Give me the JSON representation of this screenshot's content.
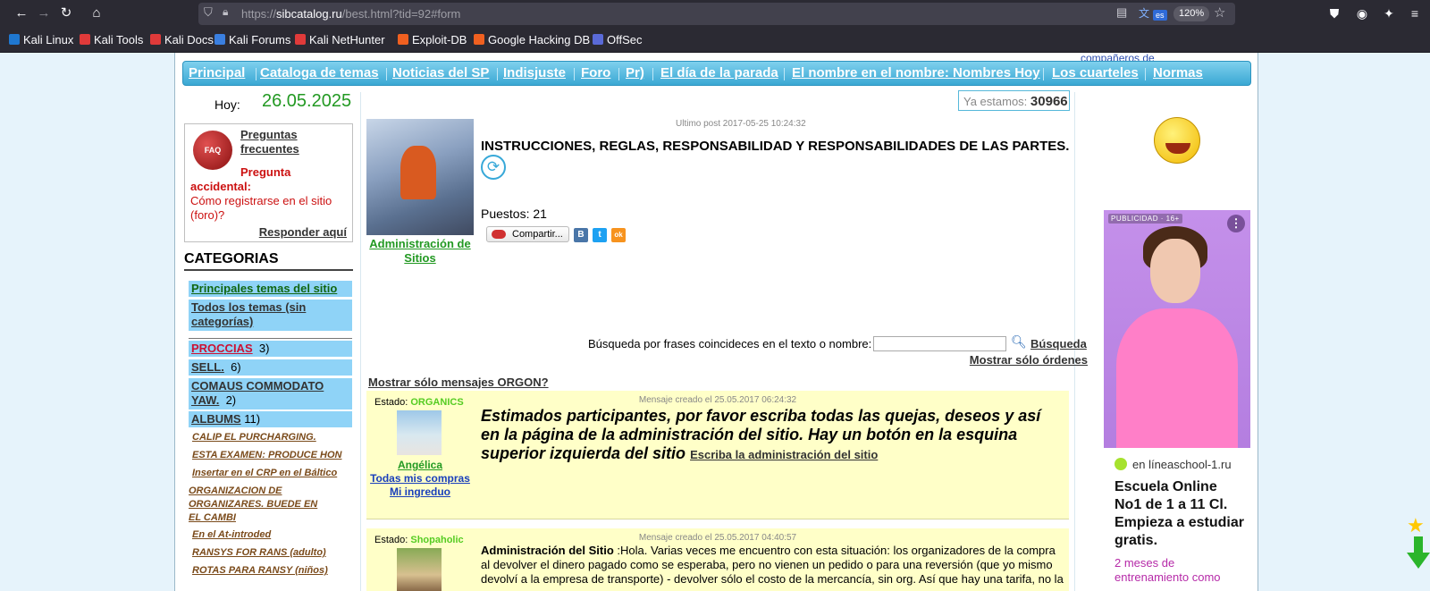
{
  "browser": {
    "url_prefix": "https://",
    "url_host": "sibcatalog.ru",
    "url_path": "/best.html?tid=92#form",
    "translate_lang": "es",
    "zoom": "120%",
    "bookmarks": [
      "Kali Linux",
      "Kali Tools",
      "Kali Docs",
      "Kali Forums",
      "Kali NetHunter",
      "Exploit-DB",
      "Google Hacking DB",
      "OffSec"
    ]
  },
  "page": {
    "top_cut_text": "compañeros de",
    "nav": [
      "Principal",
      "Cataloga de temas",
      "Noticias del SP",
      "Indisjuste",
      "Foro",
      "Pr)",
      "El día de la parada",
      "El nombre en el nombre: Nombres Hoy",
      "Los cuarteles",
      "Normas"
    ],
    "today_label": "Hoy:",
    "today_date": "26.05.2025",
    "counter_label": "Ya estamos:",
    "counter_value": "30966",
    "faq": {
      "dice_text": "FAQ",
      "title": "Preguntas frecuentes",
      "question_label_1": "Pregunta",
      "question_label_2": "accidental:",
      "question": "Cómo registrarse en el sitio (foro)?",
      "reply": "Responder aquí"
    },
    "categories_title": "CATEGORIAS",
    "categories": [
      {
        "label": "Principales temas del sitio",
        "count": ""
      },
      {
        "label": "Todos los temas (sin categorías)",
        "count": ""
      },
      {
        "label": "PROCCIAS",
        "count": "3)"
      },
      {
        "label": "SELL.",
        "count": "6)"
      },
      {
        "label": "COMAUS COMMODATO YAW.",
        "count": "2)"
      },
      {
        "label": "ALBUMS",
        "count": "11)"
      }
    ],
    "subcategories": [
      "CALIP EL PURCHARGING.",
      "ESTA EXAMEN: PRODUCE HON",
      "Insertar en el CRP en el Báltico",
      "ORGANIZACION DE ORGANIZARES. BUEDE EN EL CAMBI",
      "En el At-introded",
      "RANSYS FOR RANS (adulto)",
      "ROTAS PARA RANSY (niños)"
    ],
    "topic": {
      "author": "Administración de Sitios",
      "last_post": "Ultimo post 2017-05-25 10:24:32",
      "title": "INSTRUCCIONES, REGLAS, RESPONSABILIDAD Y RESPONSABILIDADES DE LAS PARTES.",
      "posts": "Puestos: 21",
      "share": "Compartir..."
    },
    "social": [
      {
        "icon": "vk-icon",
        "glyph": "B",
        "color": "#4a76a8"
      },
      {
        "icon": "twitter-icon",
        "glyph": "t",
        "color": "#1da1f2"
      },
      {
        "icon": "odnoklassniki-icon",
        "glyph": "ok",
        "color": "#f7931e"
      }
    ],
    "search": {
      "label": "Búsqueda por frases coincideces en el texto o nombre:",
      "button": "Búsqueda",
      "orders_link": "Mostrar sólo órdenes"
    },
    "orgon_link": "Mostrar sólo mensajes ORGON?",
    "posts": [
      {
        "date": "Mensaje creado el 25.05.2017 06:24:32",
        "status_label": "Estado:",
        "status": "ORGANICS",
        "user": "Angélica",
        "link1": "Todas mis compras",
        "link2": "Mi ingreduo",
        "body": "Estimados participantes, por favor escriba todas las quejas, deseos y así en la página de la administración del sitio. Hay un botón en la esquina superior izquierda del sitio",
        "body_link": "Escriba la administración del sitio"
      },
      {
        "date": "Mensaje creado el 25.05.2017 04:40:57",
        "status_label": "Estado:",
        "status": "Shopaholic",
        "author": "Administración del Sitio",
        "body": ":Hola. Varias veces me encuentro con esta situación: los organizadores de la compra al devolver el dinero pagado como se esperaba, pero no vienen un pedido o para una reversión (que yo mismo devolví a la empresa de transporte) - devolver sólo el costo de la mercancía, sin org. Así que hay una tarifa, no la"
      }
    ],
    "ad": {
      "badge": "PUBLICIDAD · 16+",
      "domain": "en líneaschool-1.ru",
      "headline": "Escuela Online No1 de 1 a 11 Cl. Empieza a estudiar gratis.",
      "sub": "2 meses de entrenamiento como"
    }
  }
}
